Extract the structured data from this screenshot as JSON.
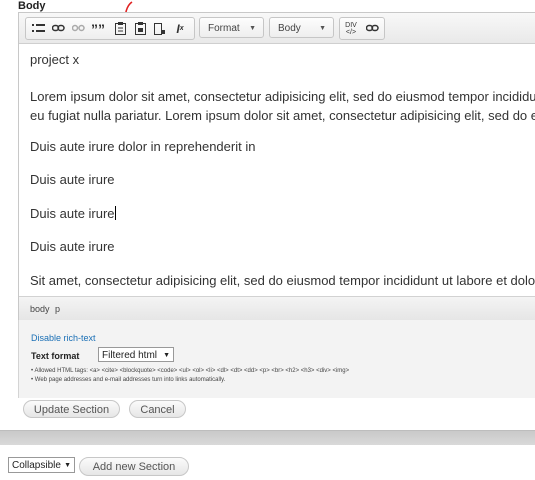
{
  "field_label": "Body",
  "toolbar": {
    "format_combo": "Format",
    "style_combo": "Body",
    "icons": [
      "bulleted-list-icon",
      "link-icon",
      "unlink-icon",
      "blockquote-icon",
      "paste-text-icon",
      "paste-word-icon",
      "anchor-icon",
      "remove-format-icon",
      "source-icon",
      "special-link-icon"
    ]
  },
  "content": {
    "p1": "project x",
    "p2": "Lorem ipsum dolor sit amet, consectetur adipisicing elit, sed do eiusmod tempor incididunt u",
    "p2b": "eu fugiat nulla pariatur. Lorem ipsum dolor sit amet, consectetur adipisicing elit, sed do eiusm",
    "p3": "Duis aute irure dolor in reprehenderit in",
    "p4": "Duis aute irure",
    "p5": "Duis aute irure",
    "p6": "Duis aute irure",
    "p7": "Sit amet, consectetur adipisicing elit, sed do eiusmod tempor incididunt ut labore et dolore m"
  },
  "pathbar": {
    "el1": "body",
    "el2": "p"
  },
  "filter": {
    "toggle_link": "Disable rich-text",
    "format_label": "Text format",
    "format_value": "Filtered html",
    "tip1": "Allowed HTML tags: <a> <cite> <blockquote> <code> <ul> <ol> <li> <dl> <dt> <dd> <p> <br> <h2> <h3> <div> <img>",
    "tip2": "Web page addresses and e-mail addresses turn into links automatically."
  },
  "buttons": {
    "update": "Update Section",
    "cancel": "Cancel",
    "add": "Add new Section"
  },
  "collapsible_select": "Collapsible",
  "colors": {
    "link": "#1a6fb5",
    "annotation": "#e02020"
  }
}
